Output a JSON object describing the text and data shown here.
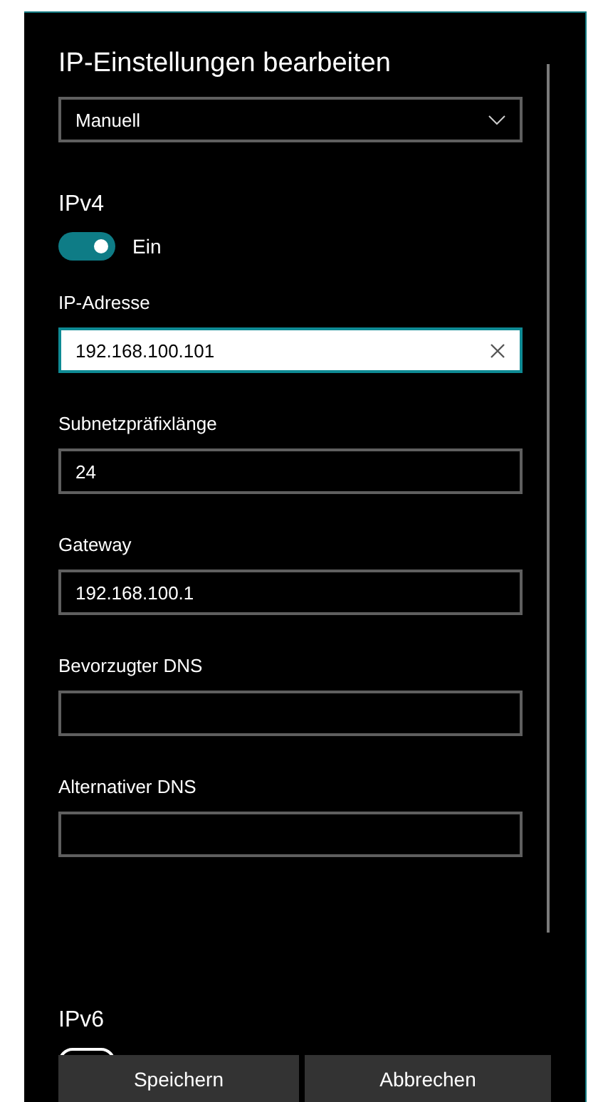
{
  "dialog": {
    "title": "IP-Einstellungen bearbeiten",
    "mode_dropdown": {
      "value": "Manuell"
    },
    "sections": [
      {
        "heading": "IPv4",
        "toggle": {
          "on": true,
          "label": "Ein"
        },
        "fields": [
          {
            "label": "IP-Adresse",
            "value": "192.168.100.101",
            "focused": true
          },
          {
            "label": "Subnetzpräfixlänge",
            "value": "24",
            "focused": false
          },
          {
            "label": "Gateway",
            "value": "192.168.100.1",
            "focused": false
          },
          {
            "label": "Bevorzugter DNS",
            "focused": false
          },
          {
            "label": "Alternativer DNS",
            "focused": false
          }
        ]
      },
      {
        "heading": "IPv6",
        "toggle": {
          "on": false
        }
      }
    ],
    "buttons": [
      "Speichern",
      "Abbrechen"
    ]
  }
}
